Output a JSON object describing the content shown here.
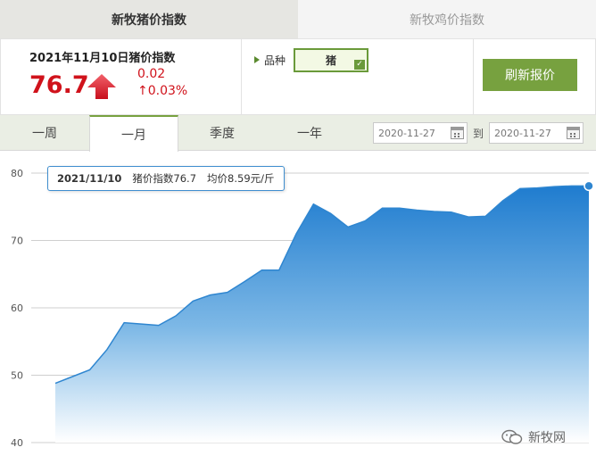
{
  "tabs": {
    "pig_index": "新牧猪价指数",
    "chicken_index": "新牧鸡价指数"
  },
  "summary": {
    "title": "2021年11月10日猪价指数",
    "value": "76.7",
    "change_abs": "0.02",
    "change_pct": "↑0.03%"
  },
  "breed": {
    "label": "品种",
    "selected": "猪",
    "check": "✓"
  },
  "refresh_label": "刷新报价",
  "periods": [
    "一周",
    "一月",
    "季度",
    "一年"
  ],
  "active_period": "一月",
  "date_from": "2020-11-27",
  "date_to": "2020-11-27",
  "to_label": "到",
  "tooltip": {
    "date": "2021/11/10",
    "index_text": "猪价指数76.7",
    "avg_text": "均价8.59元/斤"
  },
  "watermark": "新牧网",
  "colors": {
    "accent_green": "#77a13f",
    "price_red": "#d0121b",
    "chart_blue": "#2f86d0"
  },
  "chart_data": {
    "type": "area",
    "y_ticks": [
      40,
      50,
      60,
      70,
      80
    ],
    "ylim": [
      40,
      82
    ],
    "values": [
      48.8,
      49.8,
      50.8,
      53.8,
      57.8,
      57.6,
      57.4,
      58.8,
      61.0,
      61.9,
      62.3,
      63.9,
      65.6,
      65.6,
      71.0,
      75.4,
      74.0,
      72.0,
      72.9,
      74.8,
      74.8,
      74.5,
      74.3,
      74.2,
      73.5,
      73.6,
      75.9,
      77.7,
      77.8,
      78.0,
      78.1,
      78.1
    ],
    "grid": true,
    "legend": "none"
  }
}
